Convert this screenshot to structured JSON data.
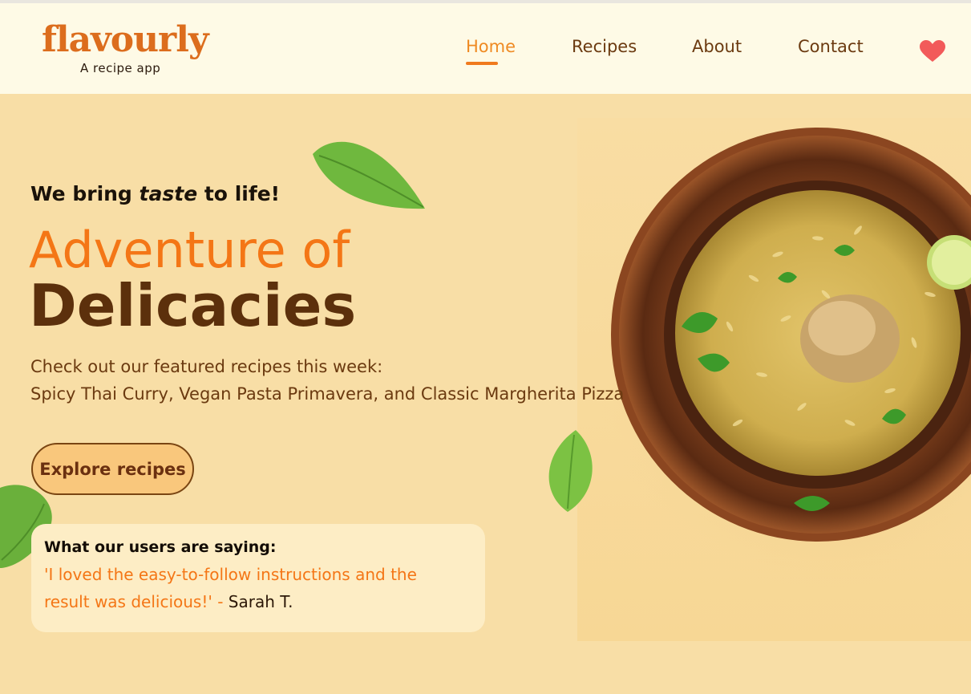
{
  "brand": {
    "name": "flavourly",
    "tagline": "A recipe app"
  },
  "nav": {
    "items": [
      {
        "label": "Home",
        "active": true
      },
      {
        "label": "Recipes",
        "active": false
      },
      {
        "label": "About",
        "active": false
      },
      {
        "label": "Contact",
        "active": false
      }
    ],
    "favorites_icon": "heart-icon"
  },
  "hero": {
    "tagline_before": "We bring ",
    "tagline_emphasis": "taste",
    "tagline_after": " to life!",
    "headline_line1": "Adventure of",
    "headline_line2": "Delicacies",
    "featured_intro": "Check out our featured recipes this week:",
    "featured_list": "Spicy Thai Curry, Vegan Pasta Primavera, and Classic Margherita Pizza",
    "cta_label": "Explore recipes"
  },
  "testimonial": {
    "heading": "What our users are saying:",
    "quote": "'I loved the easy-to-follow instructions and the result was delicious!' - ",
    "author": "Sarah T."
  },
  "colors": {
    "accent": "#f47616",
    "brown": "#5c300c",
    "background": "#f8dea6",
    "header": "#fefae6"
  }
}
